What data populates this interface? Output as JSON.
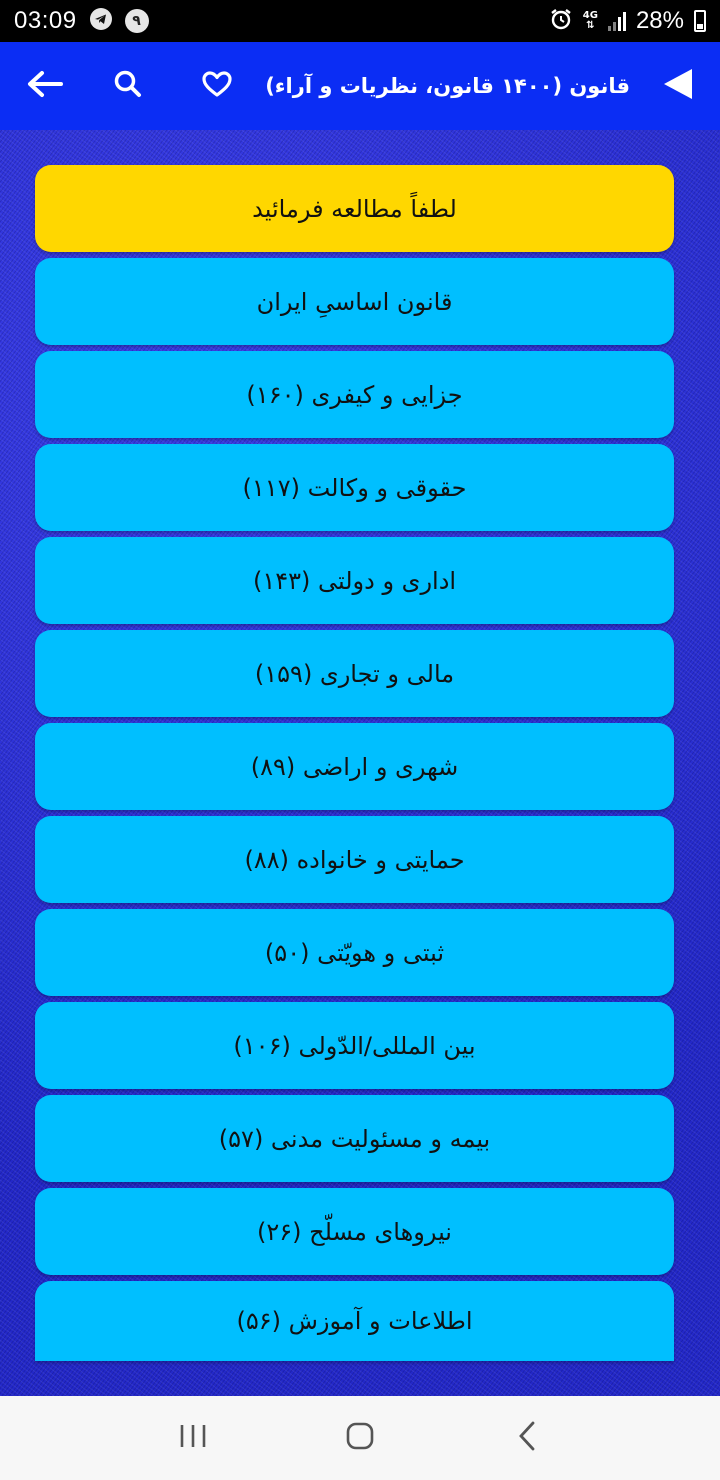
{
  "status_bar": {
    "time": "03:09",
    "notification_badge": "۹",
    "network": "4G",
    "battery": "28%"
  },
  "app_bar": {
    "title": "قانون (۱۴۰۰ قانون، نظریات و آراء)",
    "icons": [
      "back-arrow-icon",
      "search-icon",
      "heart-icon",
      "play-triangle-icon"
    ],
    "background_color": "#0b2df4"
  },
  "menu": {
    "items": [
      {
        "label": "لطفاً مطالعه فرمائید",
        "color": "#ffd700"
      },
      {
        "label": "قانون اساسیِ ایران",
        "color": "#00bfff"
      },
      {
        "label": "جزایی و کیفری (۱۶۰)",
        "color": "#00bfff"
      },
      {
        "label": "حقوقی و وکالت (۱۱۷)",
        "color": "#00bfff"
      },
      {
        "label": "اداری و دولتی (۱۴۳)",
        "color": "#00bfff"
      },
      {
        "label": "مالی و تجاری (۱۵۹)",
        "color": "#00bfff"
      },
      {
        "label": "شهری و اراضی (۸۹)",
        "color": "#00bfff"
      },
      {
        "label": "حمایتی و خانواده (۸۸)",
        "color": "#00bfff"
      },
      {
        "label": "ثبتی و هویّتی (۵۰)",
        "color": "#00bfff"
      },
      {
        "label": "بین المللی/الدّولی (۱۰۶)",
        "color": "#00bfff"
      },
      {
        "label": "بیمه و مسئولیت مدنی (۵۷)",
        "color": "#00bfff"
      },
      {
        "label": "نیروهای مسلّح (۲۶)",
        "color": "#00bfff"
      },
      {
        "label": "اطلاعات و آموزش (۵۶)",
        "color": "#00bfff"
      }
    ]
  },
  "nav_bar": {
    "icons": [
      "recent-apps-icon",
      "home-icon",
      "back-icon"
    ]
  }
}
